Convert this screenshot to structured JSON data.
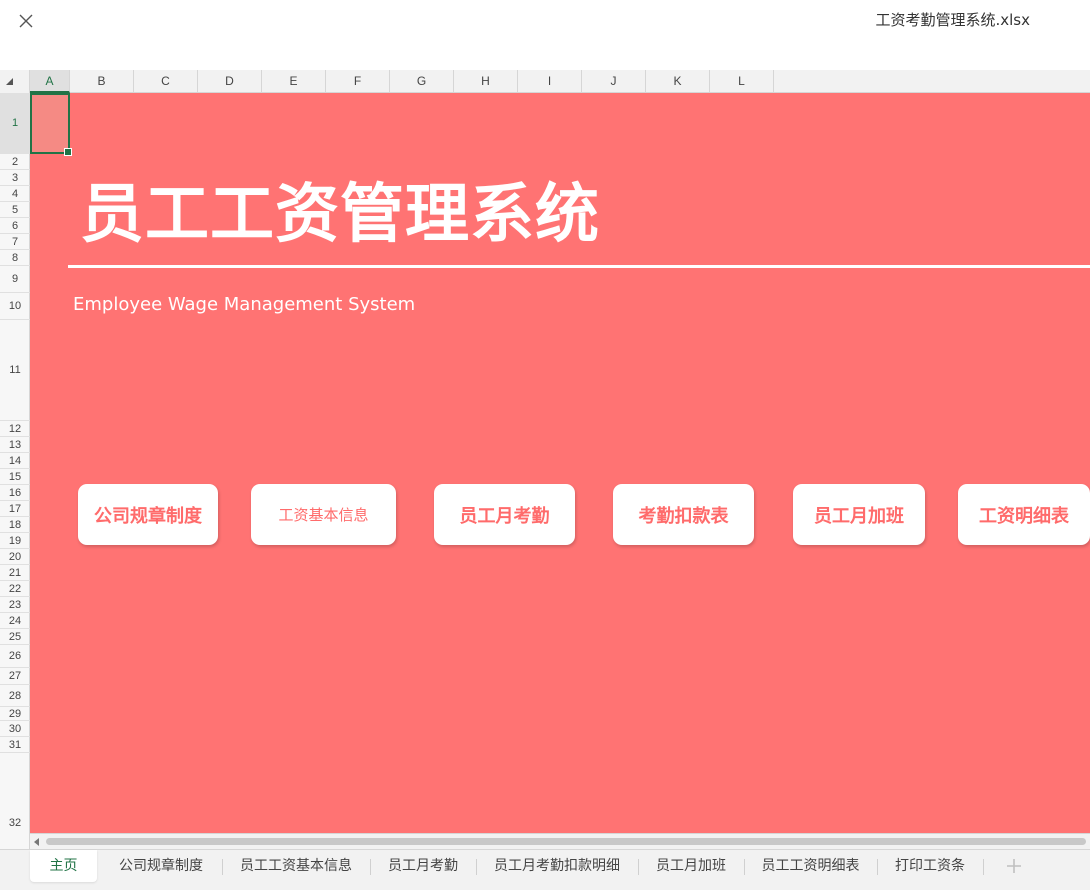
{
  "window": {
    "file_title": "工资考勤管理系统.xlsx",
    "close_icon": "close-icon"
  },
  "columns": [
    "A",
    "B",
    "C",
    "D",
    "E",
    "F",
    "G",
    "H",
    "I",
    "J",
    "K",
    "L"
  ],
  "rows": [
    "1",
    "2",
    "3",
    "4",
    "5",
    "6",
    "7",
    "8",
    "9",
    "10",
    "11",
    "12",
    "13",
    "14",
    "15",
    "16",
    "17",
    "18",
    "19",
    "20",
    "21",
    "22",
    "23",
    "24",
    "25",
    "26",
    "27",
    "28",
    "29",
    "30",
    "31",
    "32"
  ],
  "selected_cell": "A1",
  "content": {
    "title": "员工工资管理系统",
    "subtitle": "Employee Wage Management System",
    "buttons": [
      "公司规章制度",
      "工资基本信息",
      "员工月考勤",
      "考勤扣款表",
      "员工月加班",
      "工资明细表"
    ]
  },
  "tabs": [
    "主页",
    "公司规章制度",
    "员工工资基本信息",
    "员工月考勤",
    "员工月考勤扣款明细",
    "员工月加班",
    "员工工资明细表",
    "打印工资条"
  ],
  "active_tab": "主页",
  "colors": {
    "background": "#ff7373",
    "button_text": "#ff6b6b",
    "accent": "#217346"
  }
}
